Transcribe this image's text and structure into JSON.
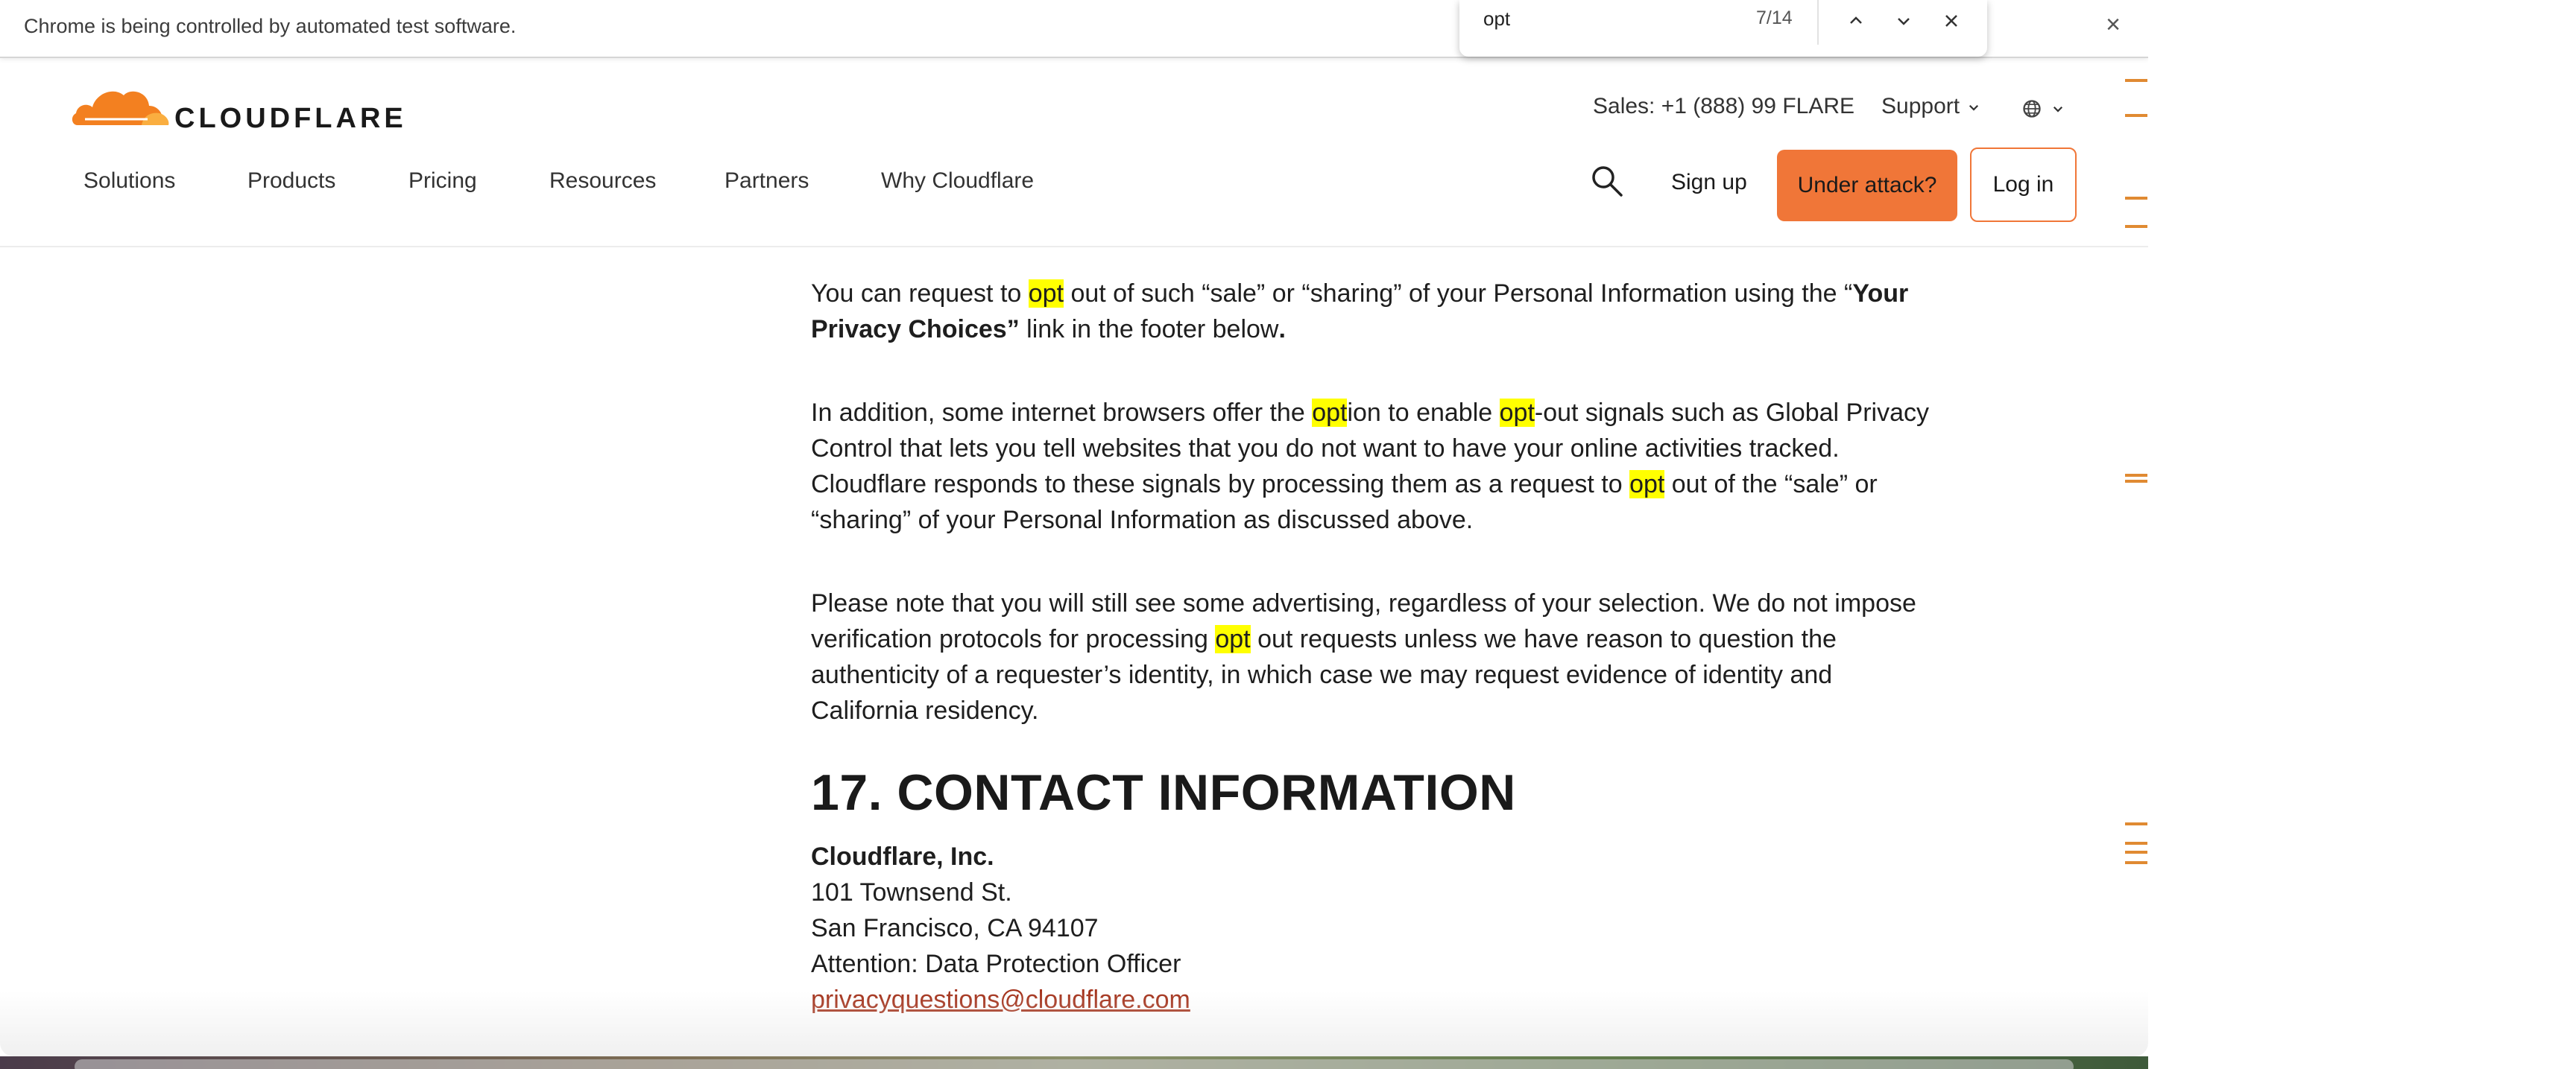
{
  "browser": {
    "infobar_text": "Chrome is being controlled by automated test software.",
    "infobar_close": "×"
  },
  "findbar": {
    "query": "opt",
    "count": "7/14",
    "prev": "⌃",
    "next": "⌄",
    "close": "✕"
  },
  "header": {
    "logo_text": "CLOUDFLARE",
    "sales": "Sales: +1 (888) 99 FLARE",
    "support": "Support",
    "support_chevron": "⌄",
    "globe_chevron": "⌄",
    "nav": [
      "Solutions",
      "Products",
      "Pricing",
      "Resources",
      "Partners",
      "Why Cloudflare"
    ],
    "sign_up": "Sign up",
    "under_attack": "Under attack?",
    "log_in": "Log in"
  },
  "content": {
    "p1": {
      "a": "You can request to ",
      "hl1": "opt",
      "b": " out of such “sale” or “sharing” of your Personal Information using the “",
      "bold": "Your Privacy Choices”",
      "c": " link in the footer below",
      "end": "."
    },
    "p2": {
      "a": "In addition, some internet browsers offer the ",
      "hl1": "opt",
      "b": "ion to enable ",
      "hl2": "opt",
      "c": "-out signals such as Global Privacy Control that lets you tell websites that you do not want to have your online activities tracked. Cloudflare responds to these signals by processing them as a request to ",
      "hl3": "opt",
      "d": " out of the “sale” or “sharing” of your Personal Information as discussed above."
    },
    "p3": {
      "a": "Please note that you will still see some advertising, regardless of your selection. We do not impose verification protocols for processing ",
      "hl1": "opt",
      "b": " out requests unless we have reason to question the authenticity of a requester’s identity, in which case we may request evidence of identity and California residency."
    },
    "heading": "17. CONTACT INFORMATION",
    "company": "Cloudflare, Inc.",
    "street": "101 Townsend St.",
    "city": "San Francisco, CA 94107",
    "attention": "Attention: Data Protection Officer",
    "email": "privacyquestions@cloudflare.com"
  },
  "colors": {
    "accent": "#f07638",
    "highlight": "#ffff00",
    "link": "#a4331c",
    "scroll_marker": "#e08a32"
  }
}
